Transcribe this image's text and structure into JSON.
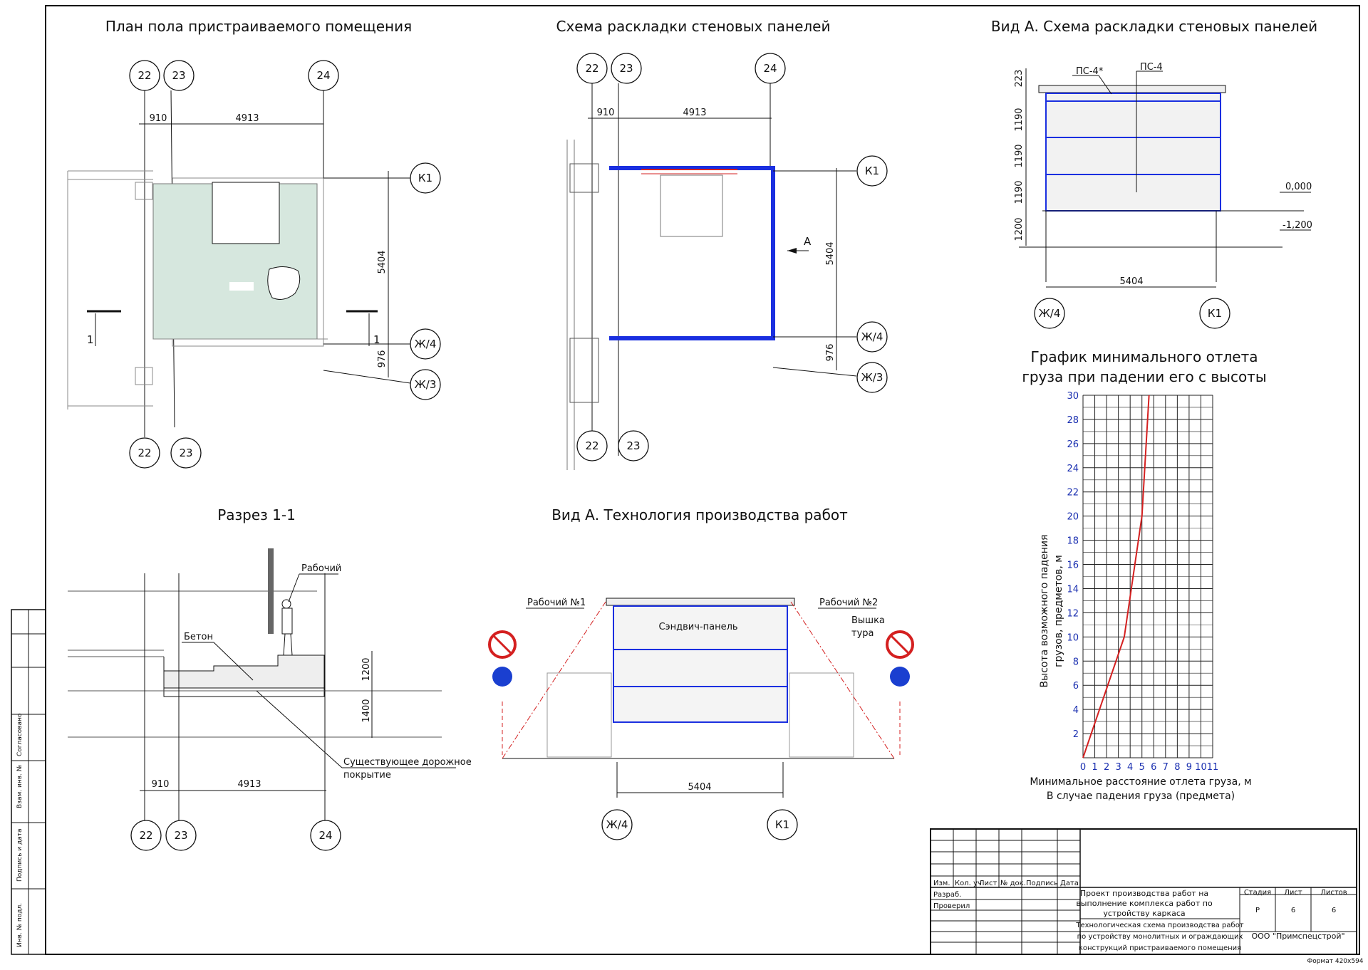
{
  "views": {
    "floor_plan": {
      "title": "План пола пристраиваемого помещения",
      "axes_top": [
        "22",
        "23",
        "24"
      ],
      "axes_bottom": [
        "22",
        "23"
      ],
      "axes_right": [
        "К1",
        "Ж/4",
        "Ж/3"
      ],
      "dims": {
        "d1": "910",
        "d2": "4913",
        "d3": "5404",
        "d4": "976"
      },
      "section_mark": "1"
    },
    "panel_layout": {
      "title": "Схема раскладки стеновых панелей",
      "axes_top": [
        "22",
        "23",
        "24"
      ],
      "axes_bottom": [
        "22",
        "23"
      ],
      "axes_right": [
        "К1",
        "Ж/4",
        "Ж/3"
      ],
      "dims": {
        "d1": "910",
        "d2": "4913",
        "d3": "5404",
        "d4": "976"
      },
      "view_mark": "А"
    },
    "view_a_layout": {
      "title": "Вид А. Схема раскладки стеновых панелей",
      "labels": {
        "ps4star": "ПС-4*",
        "ps4": "ПС-4"
      },
      "heights": [
        "223",
        "1190",
        "1190",
        "1190",
        "1200"
      ],
      "levels": [
        "0,000",
        "-1,200"
      ],
      "width": "5404",
      "axes": [
        "Ж/4",
        "К1"
      ]
    },
    "section": {
      "title": "Разрез 1-1",
      "labels": {
        "worker": "Рабочий",
        "concrete": "Бетон",
        "existing": "Существующее дорожное",
        "existing2": "покрытие"
      },
      "dims": {
        "h1": "1200",
        "h2": "1400",
        "d1": "910",
        "d2": "4913"
      },
      "axes": [
        "22",
        "23",
        "24"
      ]
    },
    "tech_view": {
      "title": "Вид А. Технология производства работ",
      "labels": {
        "w1": "Рабочий №1",
        "w2": "Рабочий №2",
        "panel": "Сэндвич-панель",
        "tower1": "Вышка",
        "tower2": "тура"
      },
      "width": "5404",
      "axes": [
        "Ж/4",
        "К1"
      ]
    }
  },
  "chart_data": {
    "type": "line",
    "title": "График минимального отлета груза при падении его с высоты",
    "title_lines": [
      "График минимального отлета",
      "груза при падении его с высоты"
    ],
    "xlabel": "Минимальное расстояние отлета груза, м",
    "xlabel2": "В случае падения груза (предмета)",
    "ylabel": "Высота возможного падения",
    "ylabel2": "грузов, предметов, м",
    "xlim": [
      0,
      11
    ],
    "ylim": [
      0,
      30
    ],
    "xticks": [
      "0",
      "1",
      "2",
      "3",
      "4",
      "5",
      "6",
      "7",
      "8",
      "9",
      "10",
      "11"
    ],
    "yticks": [
      "2",
      "4",
      "6",
      "8",
      "10",
      "12",
      "14",
      "16",
      "18",
      "20",
      "22",
      "24",
      "26",
      "28",
      "30"
    ],
    "series": [
      {
        "x": [
          0,
          3.5,
          5,
          5.6
        ],
        "y": [
          0,
          10,
          20,
          30
        ],
        "color": "#d42020"
      }
    ],
    "grid": true
  },
  "stamp": {
    "side_labels": [
      "Согласовано",
      "Взам. инв. №",
      "Подпись и дата",
      "Инв. № подл."
    ],
    "headers": [
      "Изм.",
      "Кол. уч",
      "Лист",
      "№ док.",
      "Подпись",
      "Дата"
    ],
    "rows": [
      "Разраб.",
      "Проверил"
    ],
    "project": [
      "Проект производства работ на",
      "выполнение комплекса работ по",
      "устройству каркаса"
    ],
    "stage_headers": [
      "Стадия",
      "Лист",
      "Листов"
    ],
    "stage_values": [
      "Р",
      "6",
      "6"
    ],
    "drawing": [
      "Технологическая схема производства работ",
      "по устройству монолитных и ограждающих",
      "конструкций пристраиваемого помещения"
    ],
    "company": "ООО \"Примспецстрой\"",
    "format": "Формат 420х594"
  }
}
